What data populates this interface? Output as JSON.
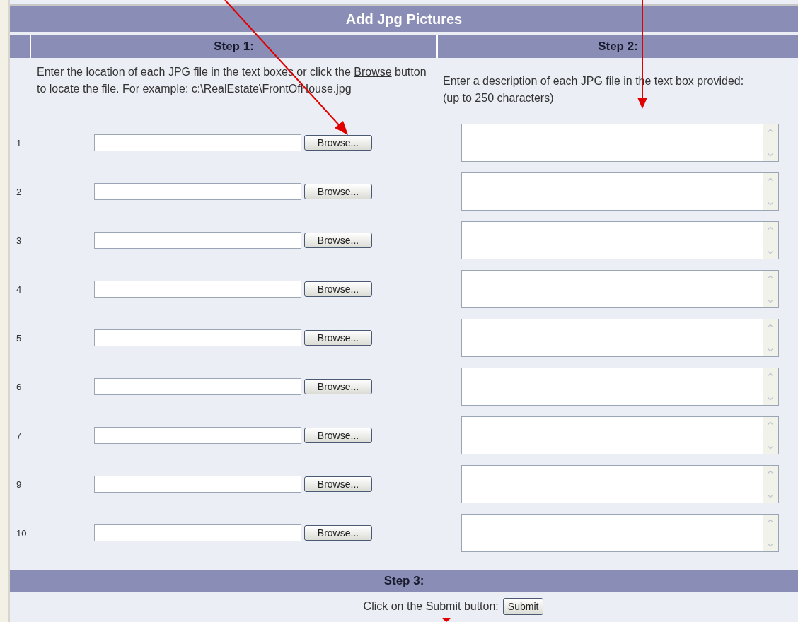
{
  "title": "Add Jpg Pictures",
  "step1": {
    "heading": "Step 1:",
    "text_before": "Enter the location of each JPG file in the text boxes or click the",
    "link": "Browse",
    "text_after": "button to locate the file. For example: c:\\RealEstate\\FrontOfHouse.jpg"
  },
  "step2": {
    "heading": "Step 2:",
    "text": "Enter a description of each JPG file in the text box provided: (up to 250 characters)"
  },
  "rows": [
    {
      "number": "1",
      "browse_label": "Browse..."
    },
    {
      "number": "2",
      "browse_label": "Browse..."
    },
    {
      "number": "3",
      "browse_label": "Browse..."
    },
    {
      "number": "4",
      "browse_label": "Browse..."
    },
    {
      "number": "5",
      "browse_label": "Browse..."
    },
    {
      "number": "6",
      "browse_label": "Browse..."
    },
    {
      "number": "7",
      "browse_label": "Browse..."
    },
    {
      "number": "9",
      "browse_label": "Browse..."
    },
    {
      "number": "10",
      "browse_label": "Browse..."
    }
  ],
  "step3": {
    "heading": "Step 3:",
    "prompt": "Click on the Submit button:",
    "submit_label": "Submit"
  }
}
